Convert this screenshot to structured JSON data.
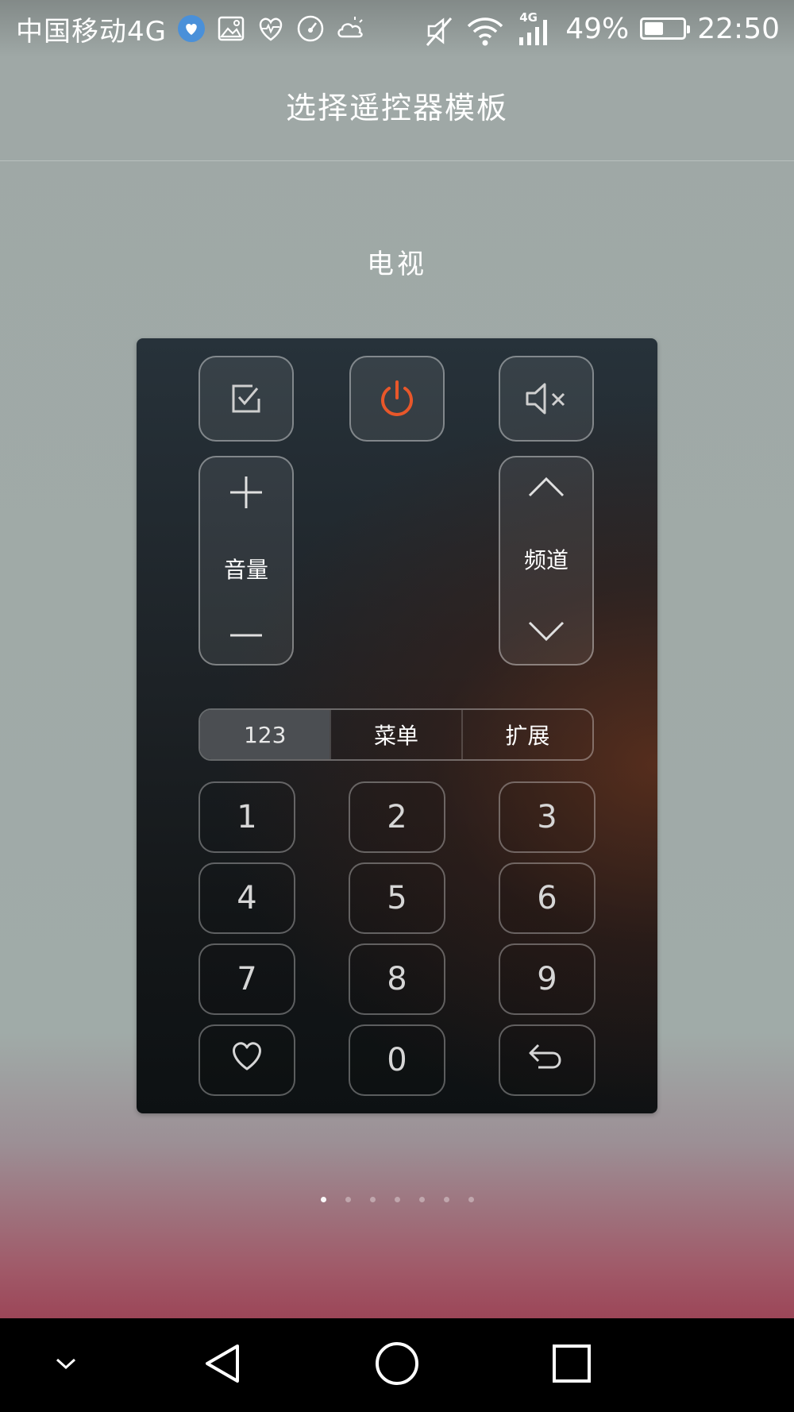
{
  "status_bar": {
    "carrier": "中国移动4G",
    "left_icons": [
      "health-app-icon",
      "image-icon",
      "heart-rate-icon",
      "speedometer-icon",
      "weather-icon"
    ],
    "right_icons": [
      "mute-icon",
      "wifi-icon",
      "signal-icon"
    ],
    "network_type": "4G",
    "battery_percent_text": "49%",
    "battery_level": 0.49,
    "time": "22:50"
  },
  "header": {
    "title": "选择遥控器模板"
  },
  "template": {
    "name": "电视"
  },
  "remote": {
    "buttons": {
      "ok": "checkbox-icon",
      "power": "power-icon",
      "mute": "mute-icon"
    },
    "power_color": "#e8572a",
    "volume_label": "音量",
    "channel_label": "频道",
    "tabs": [
      {
        "label": "123",
        "active": true
      },
      {
        "label": "菜单",
        "active": false
      },
      {
        "label": "扩展",
        "active": false
      }
    ],
    "keypad": [
      "1",
      "2",
      "3",
      "4",
      "5",
      "6",
      "7",
      "8",
      "9",
      "0"
    ],
    "favorite_icon": "heart-icon",
    "back_icon": "back-arrow-icon"
  },
  "pager": {
    "total": 7,
    "current": 1
  },
  "nav_bar": {
    "items": [
      "collapse-icon",
      "back-icon",
      "home-icon",
      "recents-icon"
    ]
  }
}
